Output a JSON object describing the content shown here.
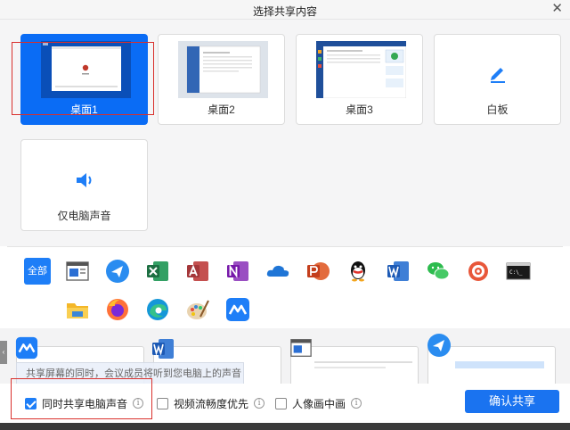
{
  "dialog": {
    "title": "选择共享内容"
  },
  "screens": [
    {
      "label": "桌面1",
      "selected": true
    },
    {
      "label": "桌面2",
      "selected": false
    },
    {
      "label": "桌面3",
      "selected": false
    },
    {
      "label": "白板",
      "selected": false
    },
    {
      "label": "仅电脑声音",
      "selected": false
    }
  ],
  "apps": {
    "all_label": "全部",
    "icons": [
      "window-icon",
      "feishu-icon",
      "excel-icon",
      "access-icon",
      "onenote-icon",
      "onedrive-icon",
      "powerpoint-icon",
      "qq-icon",
      "word-icon",
      "wechat-icon",
      "snail-app-icon",
      "terminal-icon",
      "file-explorer-icon",
      "firefox-icon",
      "edge-icon",
      "paint-icon",
      "tencent-meeting-icon"
    ]
  },
  "tooltip": "共享屏幕的同时，会议成员将听到您电脑上的声音",
  "options": [
    {
      "label": "同时共享电脑声音",
      "checked": true
    },
    {
      "label": "视频流畅度优先",
      "checked": false
    },
    {
      "label": "人像画中画",
      "checked": false
    }
  ],
  "confirm_label": "确认共享",
  "colors": {
    "accent": "#1a73f0",
    "highlight": "#d9302c"
  }
}
